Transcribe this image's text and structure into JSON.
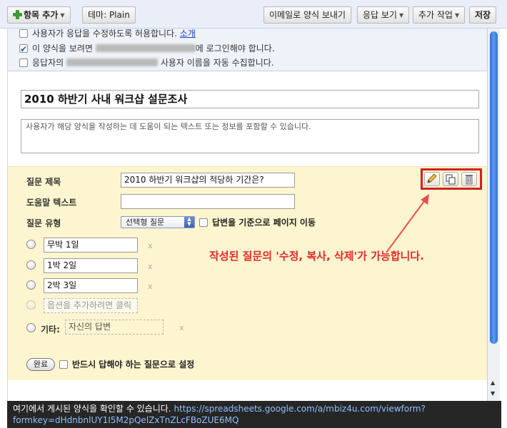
{
  "toolbar": {
    "add_item_label": "항목 추가",
    "theme_label": "테마:  Plain",
    "email_form_label": "이메일로 양식 보내기",
    "view_responses_label": "응답 보기",
    "more_actions_label": "추가 작업",
    "save_label": "저장"
  },
  "settings": {
    "allow_edit": "사용자가 응답을 수정하도록 허용합니다.",
    "allow_edit_link": "소개",
    "require_login_prefix": "이 양식을 보려면",
    "require_login_suffix": "에 로그인해야 합니다.",
    "collect_username_prefix": "응답자의",
    "collect_username_suffix": "사용자 이름을 자동 수집합니다."
  },
  "form": {
    "title": "2010 하반기 사내 워크샵 설문조사",
    "description_placeholder": "사용자가 해당 양식을 작성하는 데 도움이 되는 텍스트 또는 정보를 포함할 수 있습니다."
  },
  "question": {
    "title_label": "질문 제목",
    "title_value": "2010 하반기 워크샵의 적당하 기간은?",
    "help_label": "도움말 텍스트",
    "help_value": "",
    "type_label": "질문 유형",
    "type_value": "선택형 질문",
    "page_nav_label": "답변을 기준으로 페이지 이동",
    "options": [
      "무박 1일",
      "1박 2일",
      "2박 3일"
    ],
    "add_option_placeholder": "옵션을 추가하려면 클릭",
    "other_label": "기타:",
    "other_placeholder": "자신의 답변",
    "delete_glyph": "x",
    "done_label": "완료",
    "required_label": "반드시 답해야 하는 질문으로 설정",
    "annotation": "작성된 질문의 '수정, 복사, 삭제'가 가능합니다."
  },
  "footer": {
    "text": "여기에서 게시된 양식을 확인할 수 있습니다.",
    "url_line1": "https://spreadsheets.google.com/a/mbiz4u.com/viewform?",
    "url_line2": "formkey=dHdnbnlUY1I5M2pQelZxTnZLcFBoZUE6MQ"
  },
  "colors": {
    "accent_red": "#d42020",
    "question_bg": "#fdf5cf",
    "scroll_thumb": "#2c6fd6"
  },
  "icons": {
    "add": "plus-icon",
    "edit": "pencil-icon",
    "copy": "copy-icon",
    "delete": "trash-icon"
  }
}
